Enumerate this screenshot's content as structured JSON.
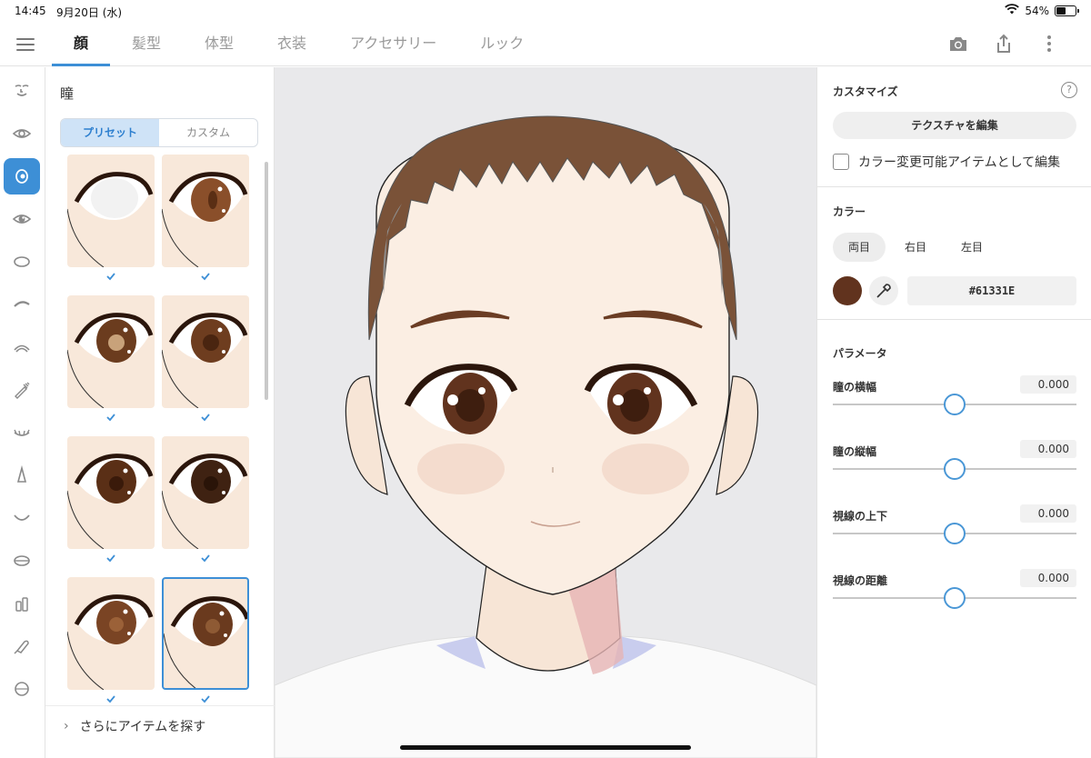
{
  "status": {
    "time": "14:45",
    "date": "9月20日 (水)",
    "battery": "54%",
    "battery_fraction": 0.54
  },
  "tabs": [
    "顔",
    "髪型",
    "体型",
    "衣装",
    "アクセサリー",
    "ルック"
  ],
  "active_tab": 0,
  "rail_icons": [
    "face-outline-icon",
    "eye-outline-icon",
    "iris-icon",
    "eye-highlight-icon",
    "eye-white-icon",
    "eyebrow-icon",
    "eyelid-icon",
    "eyeliner-icon",
    "eyelash-icon",
    "nose-icon",
    "mouth-icon",
    "lips-icon",
    "teeth-icon",
    "ear-icon",
    "face-rotate-icon"
  ],
  "rail_active": 2,
  "panel": {
    "title": "瞳",
    "segments": [
      "プリセット",
      "カスタム"
    ],
    "active_segment": 0,
    "selected_item": 7,
    "more_label": "さらにアイテムを探す"
  },
  "thumbs": [
    {
      "iris": "#f4f4f4",
      "pupil": "#ffffff",
      "kind": "white"
    },
    {
      "iris": "#8a4f2a",
      "pupil": "#5a2e14",
      "kind": "slit"
    },
    {
      "iris": "#6b3c1e",
      "pupil": "#c8a27a",
      "kind": "ring"
    },
    {
      "iris": "#6e3d1f",
      "pupil": "#4a2510",
      "kind": "ring"
    },
    {
      "iris": "#5a2f16",
      "pupil": "#3a1a0a",
      "kind": "dot"
    },
    {
      "iris": "#3f2212",
      "pupil": "#2a1408",
      "kind": "dark"
    },
    {
      "iris": "#7a4424",
      "pupil": "#9b6138",
      "kind": "soft"
    },
    {
      "iris": "#6a3a1e",
      "pupil": "#8e5a34",
      "kind": "sparkle"
    }
  ],
  "right": {
    "customize": {
      "title": "カスタマイズ",
      "texture_button": "テクスチャを編集",
      "checkbox_label": "カラー変更可能アイテムとして編集"
    },
    "color": {
      "title": "カラー",
      "eye_segments": [
        "両目",
        "右目",
        "左目"
      ],
      "active_eye": 0,
      "hex": "#61331E",
      "swatch": "#61331e"
    },
    "params": {
      "title": "パラメータ",
      "items": [
        {
          "label": "瞳の横幅",
          "value": "0.000",
          "position": 0.5
        },
        {
          "label": "瞳の縦幅",
          "value": "0.000",
          "position": 0.5
        },
        {
          "label": "視線の上下",
          "value": "0.000",
          "position": 0.5
        },
        {
          "label": "視線の距離",
          "value": "0.000",
          "position": 0.5
        }
      ]
    }
  },
  "colors": {
    "accent": "#3d8fd6",
    "skin": "#f8e8da",
    "hair": "#7a5238",
    "iris": "#61331e"
  }
}
